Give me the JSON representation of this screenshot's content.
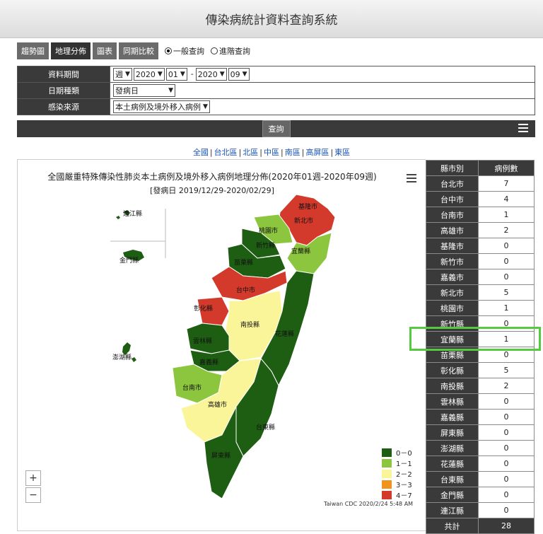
{
  "app": {
    "title": "傳染病統計資料查詢系統"
  },
  "tabs": [
    {
      "label": "趨勢圖"
    },
    {
      "label": "地理分佈"
    },
    {
      "label": "圖表"
    },
    {
      "label": "同期比較"
    }
  ],
  "query_mode": {
    "option1": "一般查詢",
    "option2": "進階查詢",
    "selected": "一般查詢"
  },
  "form": {
    "period_label": "資料期間",
    "period_unit": "週",
    "start_year": "2020",
    "start_week": "01",
    "dash": "-",
    "end_year": "2020",
    "end_week": "09",
    "date_type_label": "日期種類",
    "date_type_value": "發病日",
    "source_label": "感染來源",
    "source_value": "本土病例及境外移入病例"
  },
  "query_button": "查詢",
  "regions": [
    "全國",
    "台北區",
    "北區",
    "中區",
    "南區",
    "高屏區",
    "東區"
  ],
  "chart_data": {
    "type": "map",
    "title": "全國嚴重特殊傳染性肺炎本土病例及境外移入病例地理分佈(2020年01週-2020年09週)",
    "subtitle": "[發病日 2019/12/29-2020/02/29]",
    "credit": "Taiwan CDC 2020/2/24 5:48 AM",
    "legend": [
      {
        "label": "0－0",
        "color": "#1e5e12"
      },
      {
        "label": "1－1",
        "color": "#8cc63f"
      },
      {
        "label": "2－2",
        "color": "#fbf59a"
      },
      {
        "label": "3－3",
        "color": "#f0941e"
      },
      {
        "label": "4－7",
        "color": "#d33a2c"
      }
    ],
    "map_labels": [
      "基隆市",
      "新北市",
      "桃園市",
      "新竹縣",
      "宜蘭縣",
      "苗栗縣",
      "台中市",
      "彰化縣",
      "南投縣",
      "花蓮縣",
      "雲林縣",
      "嘉義縣",
      "台南市",
      "高雄市",
      "台東縣",
      "屏東縣",
      "連江縣",
      "金門縣",
      "澎湖縣"
    ]
  },
  "stats": {
    "header_county": "縣市別",
    "header_cases": "病例數",
    "rows": [
      {
        "name": "台北市",
        "count": "7"
      },
      {
        "name": "台中市",
        "count": "4"
      },
      {
        "name": "台南市",
        "count": "1"
      },
      {
        "name": "高雄市",
        "count": "2"
      },
      {
        "name": "基隆市",
        "count": "0"
      },
      {
        "name": "新竹市",
        "count": "0"
      },
      {
        "name": "嘉義市",
        "count": "0"
      },
      {
        "name": "新北市",
        "count": "5"
      },
      {
        "name": "桃園市",
        "count": "1"
      },
      {
        "name": "新竹縣",
        "count": "0"
      },
      {
        "name": "宜蘭縣",
        "count": "1"
      },
      {
        "name": "苗栗縣",
        "count": "0"
      },
      {
        "name": "彰化縣",
        "count": "5"
      },
      {
        "name": "南投縣",
        "count": "2"
      },
      {
        "name": "雲林縣",
        "count": "0"
      },
      {
        "name": "嘉義縣",
        "count": "0"
      },
      {
        "name": "屏東縣",
        "count": "0"
      },
      {
        "name": "澎湖縣",
        "count": "0"
      },
      {
        "name": "花蓮縣",
        "count": "0"
      },
      {
        "name": "台東縣",
        "count": "0"
      },
      {
        "name": "金門縣",
        "count": "0"
      },
      {
        "name": "連江縣",
        "count": "0"
      }
    ],
    "total_label": "共計",
    "total_count": "28"
  },
  "zoom": {
    "plus": "+",
    "minus": "−"
  }
}
